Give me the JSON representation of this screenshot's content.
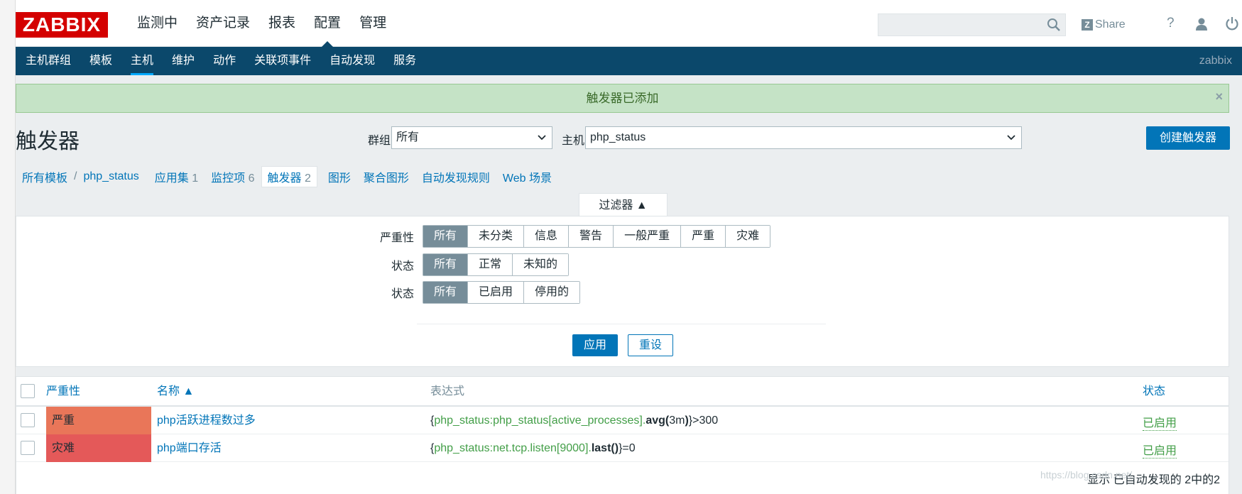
{
  "header": {
    "logo": "ZABBIX",
    "menu": [
      "监测中",
      "资产记录",
      "报表",
      "配置",
      "管理"
    ],
    "active_menu": "配置",
    "search_placeholder": "",
    "share_label": "Share",
    "help_label": "?"
  },
  "subnav": {
    "items": [
      "主机群组",
      "模板",
      "主机",
      "维护",
      "动作",
      "关联项事件",
      "自动发现",
      "服务"
    ],
    "active": "主机",
    "server_name": "zabbix"
  },
  "message": {
    "text": "触发器已添加"
  },
  "page": {
    "title": "触发器",
    "group_label": "群组",
    "group_value": "所有",
    "host_label": "主机",
    "host_value": "php_status",
    "create_button": "创建触发器"
  },
  "breadcrumbs": {
    "all_templates": "所有模板",
    "separator": "/",
    "host": "php_status",
    "tabs": [
      {
        "label": "应用集",
        "count": "1"
      },
      {
        "label": "监控项",
        "count": "6"
      },
      {
        "label": "触发器",
        "count": "2"
      },
      {
        "label": "图形",
        "count": ""
      },
      {
        "label": "聚合图形",
        "count": ""
      },
      {
        "label": "自动发现规则",
        "count": ""
      },
      {
        "label": "Web 场景",
        "count": ""
      }
    ]
  },
  "filter": {
    "tab_label": "过滤器 ▲",
    "severity_label": "严重性",
    "severity_options": [
      "所有",
      "未分类",
      "信息",
      "警告",
      "一般严重",
      "严重",
      "灾难"
    ],
    "state_label": "状态",
    "state_options": [
      "所有",
      "正常",
      "未知的"
    ],
    "status_label": "状态",
    "status_options": [
      "所有",
      "已启用",
      "停用的"
    ],
    "apply_label": "应用",
    "reset_label": "重设"
  },
  "table": {
    "columns": {
      "severity": "严重性",
      "name": "名称 ▲",
      "expression": "表达式",
      "status": "状态"
    },
    "rows": [
      {
        "severity": "严重",
        "severity_color": "#e97659",
        "name": "php活跃进程数过多",
        "expr_open": "{",
        "expr_item": "php_status:php_status[active_processes].",
        "expr_func": "avg(",
        "expr_arg": "3m",
        "expr_close": ")",
        "expr_tail": "}>300",
        "status": "已启用"
      },
      {
        "severity": "灾难",
        "severity_color": "#e45959",
        "name": "php端口存活",
        "expr_open": "{",
        "expr_item": "php_status:net.tcp.listen[9000].",
        "expr_func": "last()",
        "expr_arg": "",
        "expr_close": "",
        "expr_tail": "}=0",
        "status": "已启用"
      }
    ],
    "footer": "显示 已自动发现的 2中的2"
  },
  "watermark": "https://blog.csdn.net/..."
}
